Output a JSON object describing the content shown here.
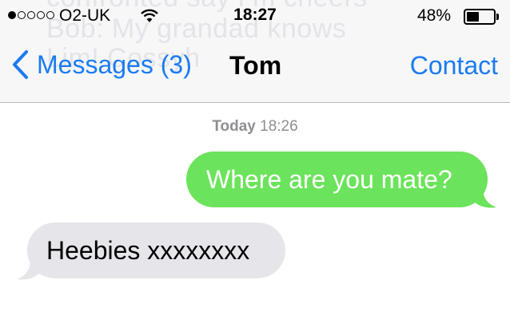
{
  "status_bar": {
    "carrier": "O2-UK",
    "signal_bars_filled": 1,
    "signal_bars_total": 5,
    "time": "18:27",
    "battery_percent": "48%",
    "battery_level": 0.48
  },
  "nav": {
    "back_label": "Messages (3)",
    "title": "Tom",
    "contact_label": "Contact"
  },
  "background_preview": {
    "line1": "confronted say i m cheers",
    "line2": "Bob: My grandad knows",
    "line3": "Lim! Cossyh"
  },
  "conversation": {
    "timestamp_day": "Today",
    "timestamp_time": "18:26",
    "messages": [
      {
        "direction": "sent",
        "text": "Where are you mate?"
      },
      {
        "direction": "received",
        "text": "Heebies xxxxxxxx"
      }
    ]
  },
  "colors": {
    "accent": "#1a7bf2",
    "sent_bubble": "#6ce35c",
    "received_bubble": "#e5e5ea"
  }
}
